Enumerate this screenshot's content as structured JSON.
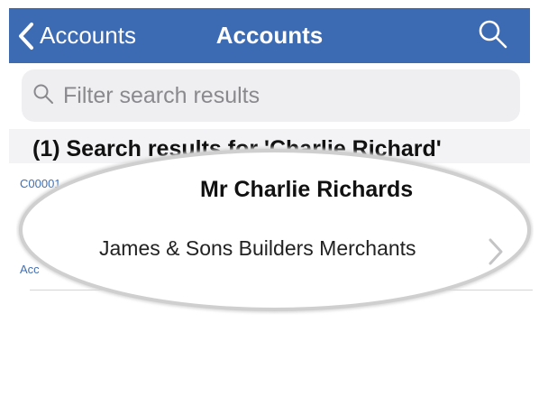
{
  "navbar": {
    "back_label": "Accounts",
    "title": "Accounts",
    "accent_color": "#3d6bb3"
  },
  "search": {
    "placeholder": "Filter search results",
    "value": ""
  },
  "results": {
    "header": "(1) Search results for 'Charlie Richard'",
    "items": [
      {
        "code": "C00001",
        "contact_name": "Mr Charlie Richards",
        "company": "James & Sons Builders Merchants",
        "account_label": "Acc"
      }
    ]
  },
  "icons": {
    "back": "chevron-left-icon",
    "search": "search-icon",
    "filter": "search-icon",
    "disclosure": "chevron-right-icon"
  }
}
